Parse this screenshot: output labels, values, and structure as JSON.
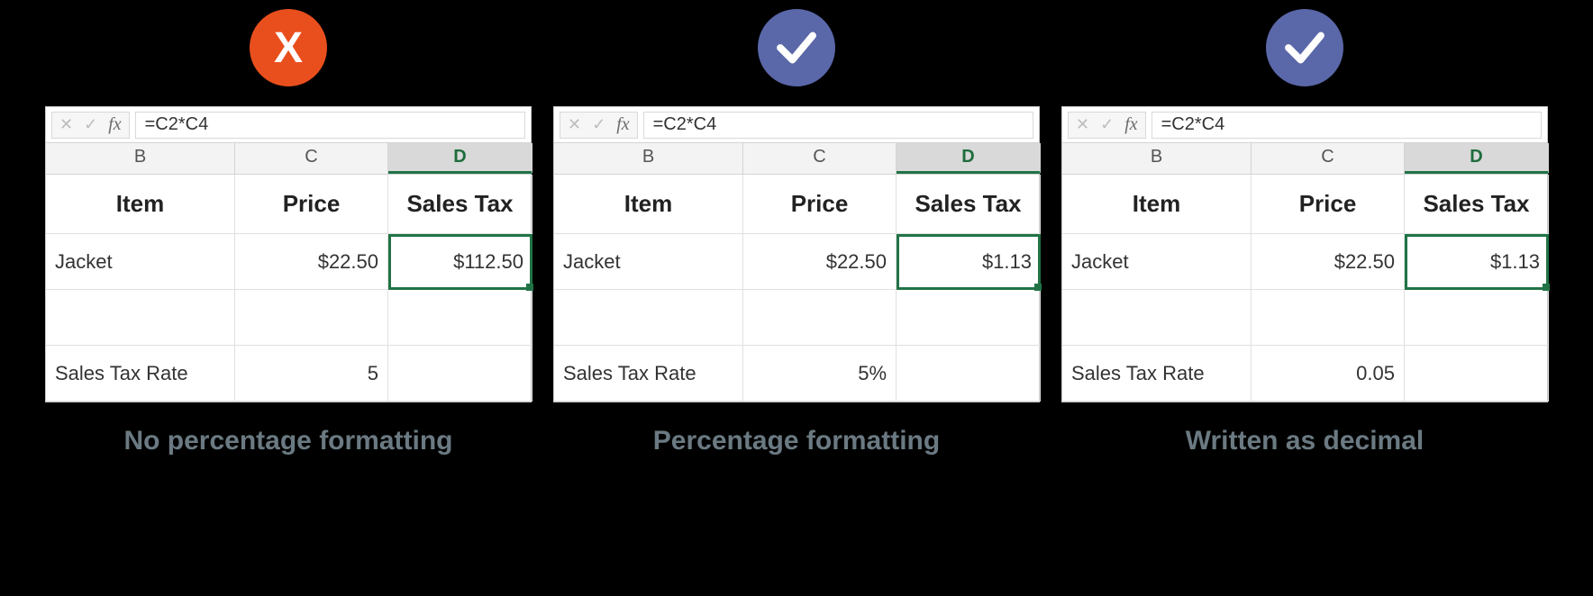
{
  "panels": [
    {
      "badge": {
        "type": "error",
        "glyph": "X"
      },
      "formula": "=C2*C4",
      "columns": [
        "B",
        "C",
        "D"
      ],
      "active_col": "D",
      "headers": {
        "item": "Item",
        "price": "Price",
        "tax": "Sales Tax"
      },
      "row_data": {
        "item": "Jacket",
        "price": "$22.50",
        "tax": "$112.50"
      },
      "row_rate": {
        "label": "Sales Tax Rate",
        "value": "5"
      },
      "caption": "No percentage formatting"
    },
    {
      "badge": {
        "type": "ok",
        "glyph": "check"
      },
      "formula": "=C2*C4",
      "columns": [
        "B",
        "C",
        "D"
      ],
      "active_col": "D",
      "headers": {
        "item": "Item",
        "price": "Price",
        "tax": "Sales Tax"
      },
      "row_data": {
        "item": "Jacket",
        "price": "$22.50",
        "tax": "$1.13"
      },
      "row_rate": {
        "label": "Sales Tax Rate",
        "value": "5%"
      },
      "caption": "Percentage formatting"
    },
    {
      "badge": {
        "type": "ok",
        "glyph": "check"
      },
      "formula": "=C2*C4",
      "columns": [
        "B",
        "C",
        "D"
      ],
      "active_col": "D",
      "headers": {
        "item": "Item",
        "price": "Price",
        "tax": "Sales Tax"
      },
      "row_data": {
        "item": "Jacket",
        "price": "$22.50",
        "tax": "$1.13"
      },
      "row_rate": {
        "label": "Sales Tax Rate",
        "value": "0.05"
      },
      "caption": "Written as decimal"
    }
  ]
}
